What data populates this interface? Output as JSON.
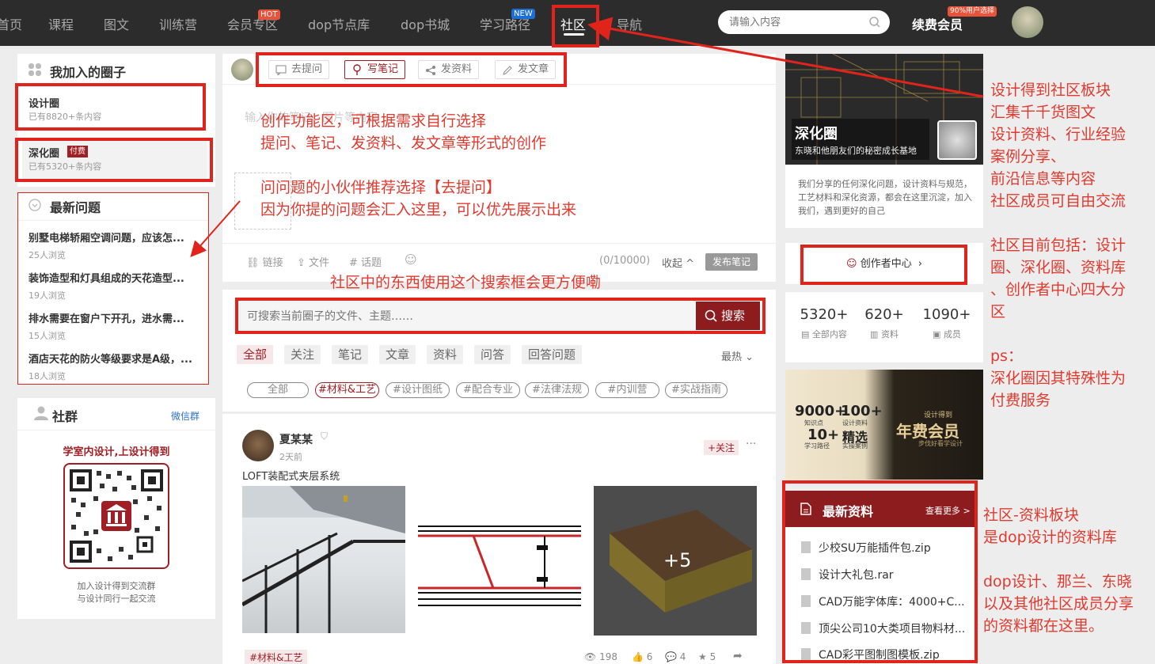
{
  "nav": {
    "items": [
      "首页",
      "课程",
      "图文",
      "训练营",
      "会员专区",
      "dop节点库",
      "dop书城",
      "学习路径",
      "社区",
      "导航"
    ],
    "hot_badge": "HOT",
    "new_badge": "NEW",
    "search_placeholder": "请输入内容",
    "renew_label": "续费会员",
    "renew_badge": "90%用户选择"
  },
  "left": {
    "my_circles_title": "我加入的圈子",
    "circles": [
      {
        "name": "设计圈",
        "count": "已有8820+条内容"
      },
      {
        "name": "深化圈",
        "badge": "付费",
        "count": "已有5320+条内容"
      }
    ],
    "latest_q_title": "最新问题",
    "questions": [
      {
        "title": "别墅电梯轿厢空调问题，应该怎...",
        "views": "25人浏览"
      },
      {
        "title": "装饰造型和灯具组成的天花造型...",
        "views": "19人浏览"
      },
      {
        "title": "排水需要在窗户下开孔，进水需...",
        "views": "15人浏览"
      },
      {
        "title": "酒店天花的防火等级要求是A级，...",
        "views": "18人浏览"
      }
    ],
    "community_title": "社群",
    "wechat_link": "微信群",
    "qr_title": "学室内设计,上设计得到",
    "qr_caption1": "加入设计得到交流群",
    "qr_caption2": "与设计同行一起交流"
  },
  "compose": {
    "buttons": [
      "去提问",
      "写笔记",
      "发资料",
      "发文章"
    ],
    "placeholder": "输入你的笔记、图片等内容",
    "tools": [
      "链接",
      "文件",
      "话题"
    ],
    "counter": "(0/10000)",
    "collapse": "收起",
    "publish": "发布笔记"
  },
  "search": {
    "placeholder": "可搜索当前圈子的文件、主题……",
    "button": "搜索"
  },
  "filters": {
    "tabs": [
      "全部",
      "关注",
      "笔记",
      "文章",
      "资料",
      "问答",
      "回答问题"
    ],
    "sort": "最热",
    "tags": [
      "全部",
      "#材料&工艺",
      "#设计图纸",
      "#配合专业",
      "#法律法规",
      "#内训营",
      "#实战指南"
    ]
  },
  "post": {
    "author": "夏某某",
    "time": "2天前",
    "follow": "+关注",
    "title": "LOFT装配式夹层系统",
    "more_images": "+5",
    "tag": "#材料&工艺",
    "views": "198",
    "likes": "6",
    "comments": "4",
    "stars": "5"
  },
  "right": {
    "circle_name": "深化圈",
    "circle_slogan": "东晓和他朋友们的秘密成长基地",
    "circle_desc": "我们分享的任何深化问题，设计资料与规范，工艺材料和深化资源，都会在这里沉淀，加入我们，遇到更好的自己",
    "creator_center": "创作者中心",
    "stats": [
      {
        "value": "5320+",
        "label": "全部内容"
      },
      {
        "value": "620+",
        "label": "资料"
      },
      {
        "value": "1090+",
        "label": "成员"
      }
    ],
    "promo": {
      "big1": "9000+",
      "sub1": "知识点",
      "big2": "100+",
      "sub2": "设计资料",
      "big3": "10+",
      "sub3": "学习路径",
      "big4": "精选",
      "sub4": "实操案例",
      "title_small": "设计得到",
      "title": "年费会员",
      "tagline": "步伐好看学设计"
    },
    "latest_res_title": "最新资料",
    "see_more": "查看更多 >",
    "files": [
      "少校SU万能插件包.zip",
      "设计大礼包.rar",
      "CAD万能字体库：4000+C...",
      "顶尖公司10大类项目物料材...",
      "CAD彩平图制图模板.zip"
    ]
  },
  "annotations": {
    "create": [
      "创作功能区，可根据需求自行选择",
      "提问、笔记、发资料、发文章等形式的创作"
    ],
    "ask": [
      "问问题的小伙伴推荐选择【去提问】",
      "因为你提的问题会汇入这里，可以优先展示出来"
    ],
    "search": "社区中的东西使用这个搜索框会更方便嘞",
    "right_top": [
      "设计得到社区板块",
      "汇集千千货图文",
      "设计资料、行业经验",
      "案例分享、",
      "前沿信息等内容",
      "社区成员可自由交流"
    ],
    "right_mid": [
      "社区目前包括：设计",
      "圈、深化圈、资料库",
      "、创作者中心四大分",
      "区"
    ],
    "right_ps": [
      "ps：",
      "深化圈因其特殊性为",
      "付费服务"
    ],
    "right_res": [
      "社区-资料板块",
      "是dop设计的资料库",
      "",
      "dop设计、那兰、东晓",
      "以及其他社区成员分享",
      "的资料都在这里。"
    ]
  }
}
